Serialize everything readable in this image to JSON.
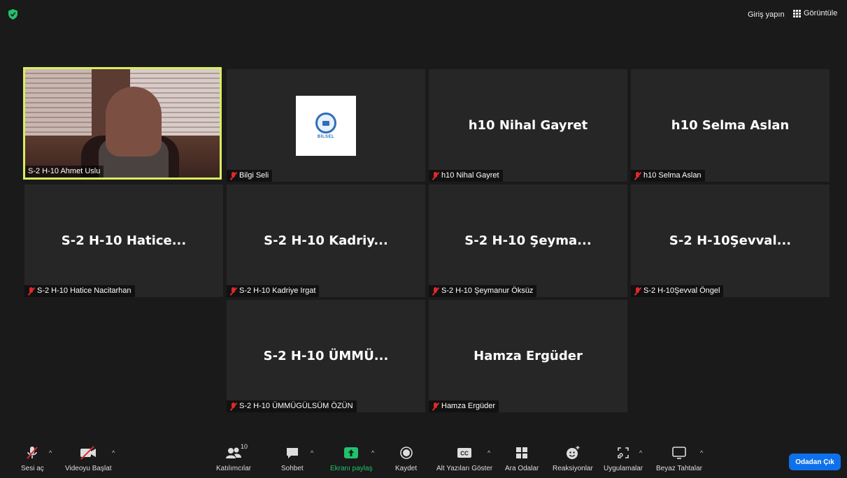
{
  "topbar": {
    "signin_label": "Giriş yapın",
    "view_label": "Görüntüle"
  },
  "tiles": [
    {
      "big": "",
      "tag": "S-2 H-10 Ahmet Uslu",
      "muted": false
    },
    {
      "big": "",
      "tag": "Bilgi Seli",
      "muted": true,
      "logo_text": "BİLSEL"
    },
    {
      "big": "h10 Nihal Gayret",
      "tag": "h10 Nihal Gayret",
      "muted": true
    },
    {
      "big": "h10 Selma Aslan",
      "tag": "h10 Selma Aslan",
      "muted": true
    },
    {
      "big": "S-2 H-10 Hatice...",
      "tag": "S-2 H-10 Hatice Nacitarhan",
      "muted": true
    },
    {
      "big": "S-2 H-10 Kadriy...",
      "tag": "S-2 H-10 Kadriye Irgat",
      "muted": true
    },
    {
      "big": "S-2 H-10 Şeyma...",
      "tag": "S-2 H-10 Şeymanur Öksüz",
      "muted": true
    },
    {
      "big": "S-2 H-10Şevval...",
      "tag": "S-2 H-10Şevval Öngel",
      "muted": true
    },
    {
      "big": "S-2 H-10 ÜMMÜ...",
      "tag": "S-2 H-10 ÜMMÜGÜLSÜM ÖZÜN",
      "muted": true
    },
    {
      "big": "Hamza Ergüder",
      "tag": "Hamza Ergüder",
      "muted": true
    }
  ],
  "toolbar": {
    "audio": "Sesi aç",
    "video": "Videoyu Başlat",
    "participants": "Katılımcılar",
    "participants_count": "10",
    "chat": "Sohbet",
    "share": "Ekranı paylaş",
    "record": "Kaydet",
    "captions": "Alt Yazıları Göster",
    "captions_icon_text": "CC",
    "breakout": "Ara Odalar",
    "reactions": "Reaksiyonlar",
    "apps": "Uygulamalar",
    "whiteboard": "Beyaz Tahtalar",
    "leave": "Odadan Çık"
  },
  "colors": {
    "active_speaker_border": "#d9ee5f",
    "share_green": "#23c16b",
    "leave_blue": "#0e71eb",
    "muted_red": "#e02828"
  }
}
